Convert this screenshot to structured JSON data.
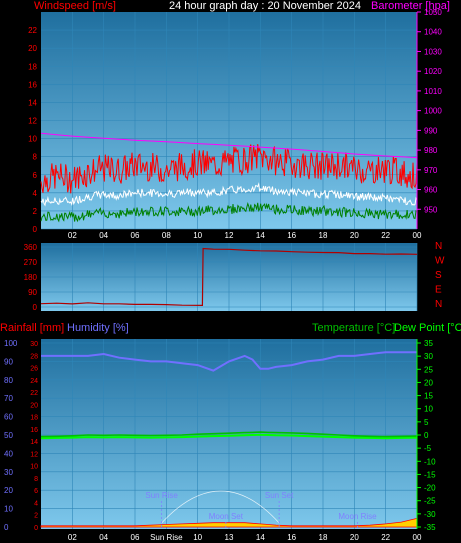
{
  "header": {
    "left_label": "Windspeed [m/s]",
    "title": "24 hour graph day : 20 November 2024",
    "right_label": "Barometer [hpa]"
  },
  "colors": {
    "plot_top": "#1f6f9f",
    "plot_bottom": "#7ec8ec",
    "windspeed": "#ff0000",
    "gust_avg": "#ffffff",
    "wind_base": "#008000",
    "barometer": "#ff00ff",
    "direction": "#b00000",
    "rain_axis": "#ff0000",
    "humidity": "#7070ff",
    "temperature": "#00c000",
    "dewpoint": "#00ff00",
    "annotation": "#8080ff",
    "rain_fill": "#ffd000"
  },
  "chart_data": [
    {
      "type": "line",
      "title": "24 hour graph day : 20 November 2024",
      "x_tick_labels": [
        "02",
        "04",
        "06",
        "08",
        "10",
        "12",
        "14",
        "16",
        "18",
        "20",
        "22",
        "00"
      ],
      "y_left": {
        "label": "Windspeed [m/s]",
        "ylim": [
          0,
          24
        ],
        "tick_labels": [
          "0",
          "2",
          "4",
          "6",
          "8",
          "10",
          "12",
          "14",
          "16",
          "18",
          "20",
          "22"
        ]
      },
      "y_right": {
        "label": "Barometer [hpa]",
        "ylim": [
          940,
          1050
        ],
        "tick_labels": [
          "950",
          "960",
          "970",
          "980",
          "990",
          "1000",
          "1010",
          "1020",
          "1030",
          "1040",
          "1050"
        ]
      },
      "hours": [
        0,
        1,
        2,
        3,
        4,
        5,
        6,
        7,
        8,
        9,
        10,
        11,
        12,
        13,
        14,
        15,
        16,
        17,
        18,
        19,
        20,
        21,
        22,
        23,
        24
      ],
      "series": [
        {
          "name": "Windspeed",
          "axis": "left",
          "values": [
            4.8,
            5.4,
            5.0,
            5.8,
            6.2,
            6.0,
            6.6,
            6.4,
            6.0,
            6.5,
            6.8,
            6.6,
            7.0,
            7.2,
            7.6,
            7.0,
            6.8,
            6.6,
            6.4,
            6.6,
            6.2,
            6.0,
            6.2,
            5.8,
            5.2
          ]
        },
        {
          "name": "Average",
          "axis": "left",
          "values": [
            3.0,
            3.1,
            3.1,
            3.6,
            3.8,
            3.7,
            4.0,
            4.0,
            3.9,
            4.0,
            4.1,
            4.0,
            4.3,
            4.4,
            4.6,
            4.2,
            4.1,
            3.9,
            3.9,
            3.8,
            3.6,
            3.5,
            3.4,
            3.2,
            3.0
          ]
        },
        {
          "name": "Low",
          "axis": "left",
          "values": [
            1.3,
            1.4,
            1.3,
            1.6,
            1.8,
            1.7,
            1.9,
            2.0,
            2.0,
            1.9,
            2.0,
            2.1,
            2.2,
            2.3,
            2.4,
            2.2,
            2.1,
            2.0,
            2.0,
            1.9,
            1.8,
            1.7,
            1.6,
            1.6,
            1.5
          ]
        },
        {
          "name": "Barometer",
          "axis": "right",
          "values": [
            988.5,
            987.8,
            987.1,
            986.5,
            986.0,
            985.5,
            985.0,
            984.6,
            984.2,
            983.8,
            983.3,
            982.9,
            982.5,
            982.0,
            981.5,
            981.0,
            980.5,
            979.9,
            979.3,
            978.7,
            978.0,
            977.5,
            977.0,
            976.6,
            976.2
          ]
        }
      ]
    },
    {
      "type": "line",
      "title": "",
      "x_tick_labels": [
        "02",
        "04",
        "06",
        "08",
        "10",
        "12",
        "14",
        "16",
        "18",
        "20",
        "22",
        "00"
      ],
      "y_left": {
        "ylim": [
          0,
          360
        ],
        "tick_labels": [
          "0",
          "90",
          "180",
          "270",
          "360"
        ]
      },
      "y_right": {
        "tick_labels": [
          "N",
          "W",
          "S",
          "E",
          "N"
        ]
      },
      "hours": [
        0,
        1,
        2,
        3,
        4,
        5,
        6,
        7,
        8,
        9,
        10.3,
        10.35,
        11,
        12,
        13,
        14,
        15,
        16,
        17,
        18,
        19,
        20,
        21,
        22,
        23,
        24
      ],
      "series": [
        {
          "name": "Wind direction",
          "values": [
            20,
            22,
            20,
            25,
            18,
            20,
            17,
            15,
            14,
            12,
            8,
            350,
            348,
            345,
            342,
            338,
            335,
            333,
            330,
            328,
            325,
            322,
            320,
            318,
            318,
            316
          ]
        }
      ]
    },
    {
      "type": "line",
      "title": "",
      "header_labels": {
        "rain": "Rainfall [mm]",
        "humidity": "Humidity [%]",
        "temperature": "Temperature [°C]",
        "dewpoint": "Dew Point [°C]"
      },
      "x_tick_labels": [
        "02",
        "04",
        "06",
        "Sun Rise",
        "10",
        "13",
        "14",
        "16",
        "18",
        "20",
        "22",
        "00"
      ],
      "y_humidity": {
        "ylim": [
          0,
          100
        ],
        "tick_labels": [
          "0",
          "10",
          "20",
          "30",
          "40",
          "50",
          "60",
          "70",
          "80",
          "90",
          "100"
        ]
      },
      "y_rain": {
        "ylim": [
          0,
          30
        ],
        "tick_labels": [
          "0",
          "2",
          "4",
          "6",
          "8",
          "10",
          "12",
          "14",
          "16",
          "18",
          "20",
          "22",
          "24",
          "26",
          "28",
          "30"
        ]
      },
      "y_temp": {
        "ylim": [
          -35,
          35
        ],
        "tick_labels": [
          "35",
          "30",
          "25",
          "20",
          "15",
          "10",
          "5",
          "0",
          "-5",
          "-10",
          "-15",
          "-20",
          "-25",
          "-30",
          "-35"
        ]
      },
      "annotations": [
        {
          "text": "Sun Rise",
          "hour": 7.7
        },
        {
          "text": "Sun Set",
          "hour": 15.2
        },
        {
          "text": "Moon Set",
          "hour": 11.8
        },
        {
          "text": "Moon Rise",
          "hour": 20.2
        }
      ],
      "hours": [
        0,
        1,
        2,
        3,
        4,
        5,
        6,
        7,
        8,
        9,
        10,
        11,
        12,
        13,
        13.5,
        14,
        14.5,
        15,
        16,
        17,
        18,
        19,
        20,
        21,
        22,
        23,
        24
      ],
      "series": [
        {
          "name": "Humidity",
          "axis": "humidity",
          "values": [
            93,
            93,
            93,
            93,
            94,
            92,
            91,
            90,
            90,
            89,
            88,
            85,
            90,
            93,
            91,
            86,
            86,
            87,
            88,
            90,
            91,
            93,
            93,
            94,
            95,
            95,
            95
          ]
        },
        {
          "name": "Temperature",
          "axis": "temp",
          "values": [
            -0.6,
            -0.5,
            -0.3,
            0.0,
            -0.1,
            0.0,
            -0.1,
            -0.2,
            -0.1,
            0.0,
            0.3,
            0.5,
            0.7,
            0.9,
            1.0,
            1.1,
            1.0,
            0.9,
            0.8,
            0.6,
            0.3,
            0.0,
            -0.3,
            -0.5,
            -0.6,
            -0.5,
            -0.4
          ]
        },
        {
          "name": "Dew Point",
          "axis": "temp",
          "values": [
            -1.2,
            -1.1,
            -1.0,
            -0.8,
            -0.9,
            -0.8,
            -0.9,
            -1.0,
            -0.9,
            -0.8,
            -0.6,
            -0.4,
            -0.3,
            -0.1,
            0.0,
            0.1,
            0.0,
            -0.1,
            -0.2,
            -0.4,
            -0.6,
            -0.8,
            -1.0,
            -1.1,
            -1.2,
            -1.1,
            -1.0
          ]
        },
        {
          "name": "Rainfall",
          "axis": "rain",
          "values": [
            0.2,
            0.2,
            0.2,
            0.2,
            0.2,
            0.2,
            0.2,
            0.3,
            0.4,
            0.5,
            0.6,
            0.7,
            0.7,
            0.7,
            0.6,
            0.5,
            0.4,
            0.3,
            0.2,
            0.2,
            0.2,
            0.2,
            0.2,
            0.3,
            0.5,
            0.8,
            1.4
          ]
        }
      ]
    }
  ]
}
